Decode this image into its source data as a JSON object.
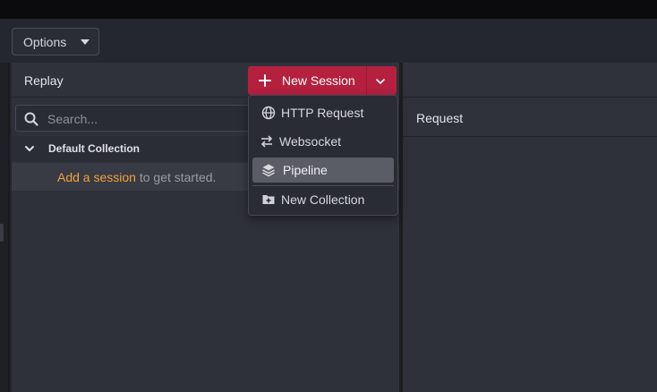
{
  "toolbar": {
    "options_label": "Options"
  },
  "replay": {
    "title": "Replay",
    "search_placeholder": "Search...",
    "collection_name": "Default Collection",
    "hint_link": "Add a session",
    "hint_rest": " to get started."
  },
  "request": {
    "title": "Request"
  },
  "new_session": {
    "label": "New Session",
    "icon": "plus-icon"
  },
  "menu": {
    "items": [
      {
        "label": "HTTP Request",
        "icon": "globe-icon"
      },
      {
        "label": "Websocket",
        "icon": "arrows-swap-icon"
      },
      {
        "label": "Pipeline",
        "icon": "layers-icon"
      },
      {
        "label": "New Collection",
        "icon": "folder-plus-icon"
      }
    ],
    "active_item": "Pipeline"
  },
  "colors": {
    "accent": "#b5203f",
    "link": "#f2a33a",
    "background": "#25272e",
    "panel": "#2f313a"
  }
}
